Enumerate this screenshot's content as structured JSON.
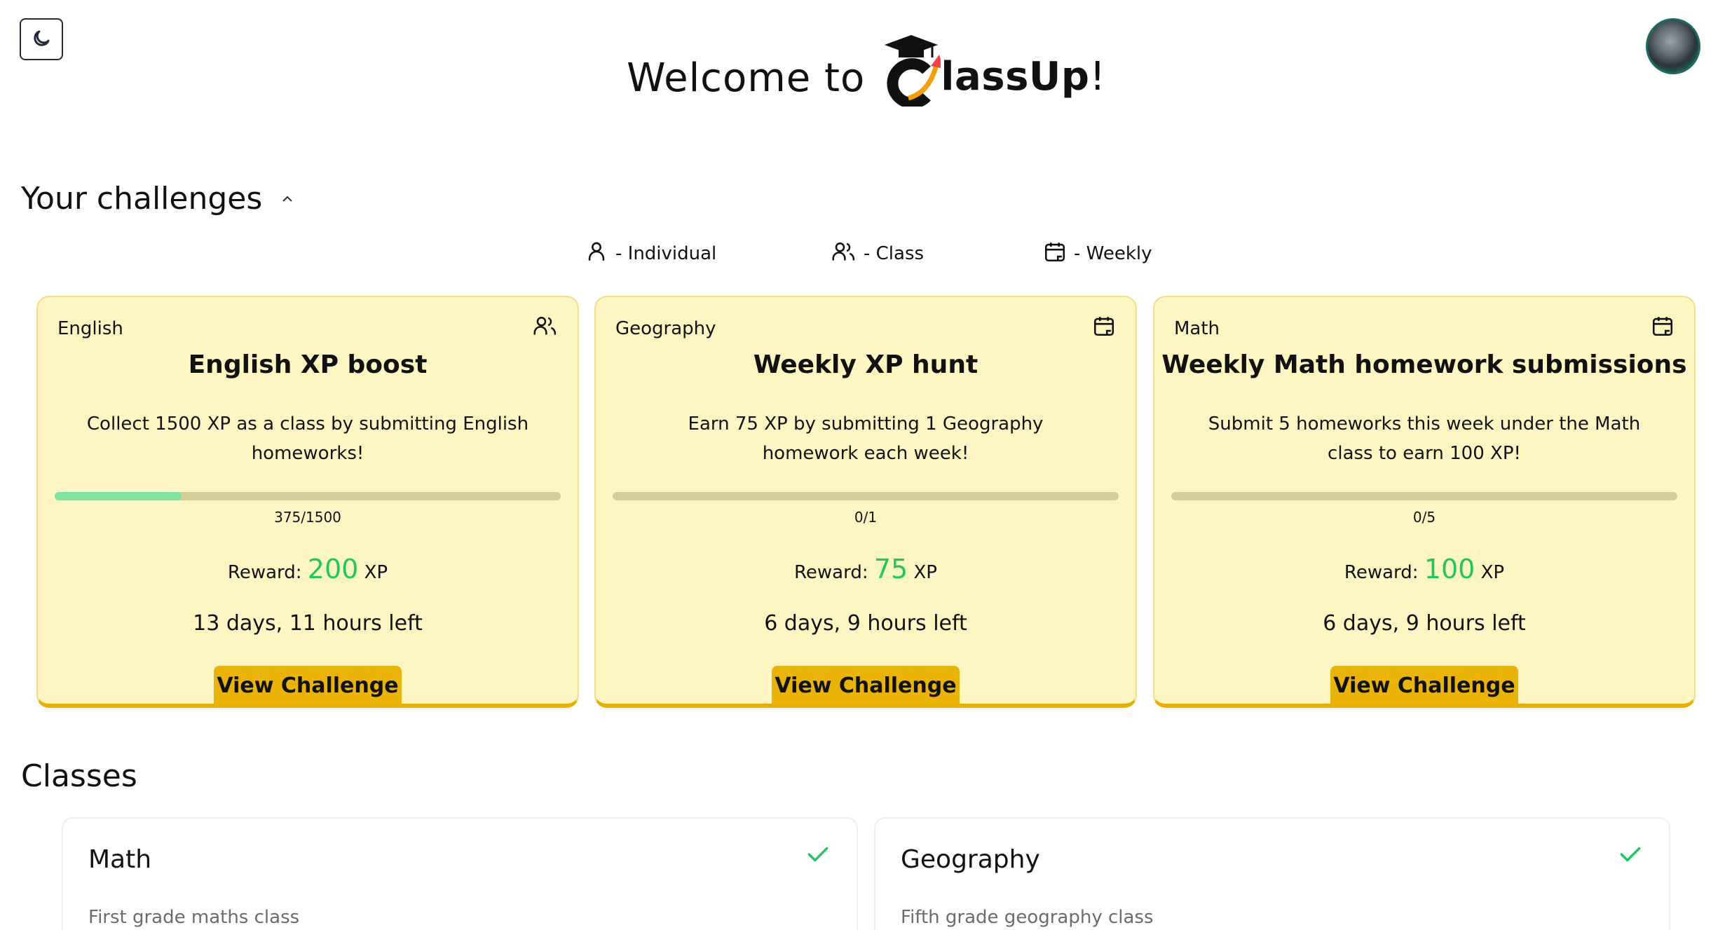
{
  "header": {
    "welcome_text": "Welcome to",
    "logo_text": "lassUp",
    "logo_exclaim": "!",
    "theme_toggle_icon": "moon-icon",
    "avatar_icon": "moon-avatar"
  },
  "challenges": {
    "title": "Your challenges",
    "legend": [
      {
        "icon": "user-icon",
        "label": "- Individual"
      },
      {
        "icon": "users-icon",
        "label": "- Class"
      },
      {
        "icon": "calendar-icon",
        "label": "- Weekly"
      }
    ],
    "cards": [
      {
        "subject": "English",
        "type_icon": "users-icon",
        "title": "English XP boost",
        "description": "Collect 1500 XP as a class by submitting English homeworks!",
        "progress": 0.25,
        "progress_label": "375/1500",
        "reward_prefix": "Reward:",
        "reward_value": "200",
        "reward_suffix": "XP",
        "time_left": "13 days, 11 hours left",
        "button": "View Challenge"
      },
      {
        "subject": "Geography",
        "type_icon": "calendar-icon",
        "title": "Weekly XP hunt",
        "description": "Earn 75 XP by submitting 1 Geography homework each week!",
        "progress": 0,
        "progress_label": "0/1",
        "reward_prefix": "Reward:",
        "reward_value": "75",
        "reward_suffix": "XP",
        "time_left": "6 days, 9 hours left",
        "button": "View Challenge"
      },
      {
        "subject": "Math",
        "type_icon": "calendar-icon",
        "title": "Weekly Math homework submissions",
        "description": "Submit 5 homeworks this week under the Math class to earn 100 XP!",
        "progress": 0,
        "progress_label": "0/5",
        "reward_prefix": "Reward:",
        "reward_value": "100",
        "reward_suffix": "XP",
        "time_left": "6 days, 9 hours left",
        "button": "View Challenge"
      }
    ]
  },
  "classes": {
    "title": "Classes",
    "items": [
      {
        "name": "Math",
        "description": "First grade maths class",
        "status_icon": "check-icon"
      },
      {
        "name": "Geography",
        "description": "Fifth grade geography class",
        "status_icon": "check-icon"
      }
    ]
  },
  "colors": {
    "card_bg": "#fef6c2",
    "accent_yellow": "#eab308",
    "reward_green": "#22c55e",
    "progress_fill": "#7fe3a0"
  }
}
